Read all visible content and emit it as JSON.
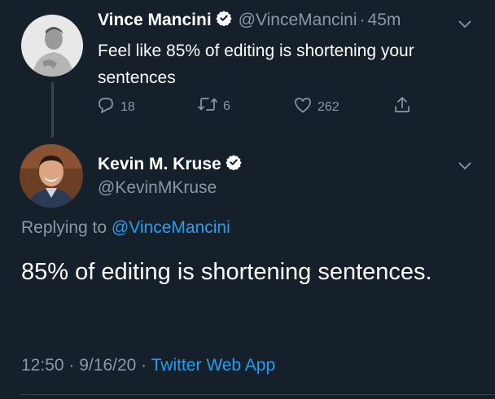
{
  "colors": {
    "background": "#15202b",
    "text": "#ffffff",
    "muted": "#8899a6",
    "accent": "#1da1f2"
  },
  "tweet1": {
    "name": "Vince Mancini",
    "handle": "@VinceMancini",
    "dot": "·",
    "time": "45m",
    "text": "Feel like 85% of editing is shortening your sentences",
    "reply_count": "18",
    "retweet_count": "6",
    "like_count": "262"
  },
  "tweet2": {
    "name": "Kevin M. Kruse",
    "handle": "@KevinMKruse",
    "replying_prefix": "Replying to",
    "replying_to": "@VinceMancini",
    "text": "85% of editing is shortening sentences.",
    "time": "12:50",
    "dot1": "·",
    "date": "9/16/20",
    "dot2": "·",
    "source": "Twitter Web App"
  }
}
